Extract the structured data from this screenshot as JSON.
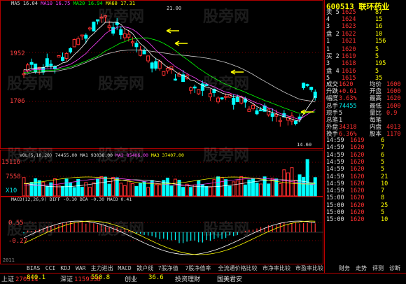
{
  "stock": {
    "code_title": "600513 联环药业"
  },
  "main_chart": {
    "ma_header": [
      "MA5 16.04",
      "MA10 16.75",
      "MA20 16.94",
      "MA60 17.31"
    ],
    "y_labels": [
      "1952",
      "1706"
    ],
    "high_label": "21.00",
    "low_label": "14.60"
  },
  "volume_chart": {
    "header": [
      "VOL(5,10,20)",
      "74455.00",
      "MA1 93038.00",
      "MA2 85406.00",
      "MA3 37407.00"
    ],
    "y_labels": [
      "15116",
      "7558",
      "X10"
    ]
  },
  "macd_chart": {
    "header": "MACD(12,26,9)  DIFF -0.10  DEA -0.30  MACD 0.41",
    "y_labels": [
      "0.55",
      "-0.27"
    ]
  },
  "order_book": [
    {
      "side": "卖",
      "level": "5",
      "price": "1625",
      "vol": "87"
    },
    {
      "side": "",
      "level": "4",
      "price": "1624",
      "vol": "15"
    },
    {
      "side": "",
      "level": "3",
      "price": "1623",
      "vol": "16"
    },
    {
      "side": "盘",
      "level": "2",
      "price": "1622",
      "vol": "10"
    },
    {
      "side": "",
      "level": "1",
      "price": "1621",
      "vol": "156"
    },
    {
      "side": "",
      "level": "1",
      "price": "1620",
      "vol": "5"
    },
    {
      "side": "买",
      "level": "2",
      "price": "1619",
      "vol": "5"
    },
    {
      "side": "",
      "level": "3",
      "price": "1618",
      "vol": "195"
    },
    {
      "side": "盘",
      "level": "4",
      "price": "1616",
      "vol": "5"
    },
    {
      "side": "",
      "level": "5",
      "price": "1615",
      "vol": "35"
    }
  ],
  "quote_stats": [
    {
      "label": "成交",
      "value": "1620",
      "label2": "均价",
      "value2": "1600"
    },
    {
      "label": "升跌",
      "value": "+0.61",
      "label2": "开盘",
      "value2": "1600"
    },
    {
      "label": "幅度",
      "value": "3.63%",
      "label2": "最高",
      "value2": "1620"
    },
    {
      "label": "总手",
      "value": "74455",
      "label2": "最低",
      "value2": "1600"
    },
    {
      "label": "现手",
      "value": "5",
      "label2": "量比",
      "value2": "0.9"
    },
    {
      "label": "总笔",
      "value": "1",
      "label2": "每笔",
      "value2": ""
    },
    {
      "label": "外盘",
      "value": "34318",
      "label2": "内盘",
      "value2": "4013"
    },
    {
      "label": "换手",
      "value": "6.36%",
      "label2": "股本",
      "value2": "1170"
    }
  ],
  "trades": [
    {
      "time": "14:59",
      "price": "1619",
      "vol": "6"
    },
    {
      "time": "14:59",
      "price": "1620",
      "vol": "7"
    },
    {
      "time": "14:59",
      "price": "1620",
      "vol": "6"
    },
    {
      "time": "14:59",
      "price": "1620",
      "vol": "5"
    },
    {
      "time": "14:59",
      "price": "1620",
      "vol": "5"
    },
    {
      "time": "14:59",
      "price": "1620",
      "vol": "21"
    },
    {
      "time": "14:59",
      "price": "1620",
      "vol": "10"
    },
    {
      "time": "14:59",
      "price": "1620",
      "vol": "7"
    },
    {
      "time": "15:00",
      "price": "1620",
      "vol": "8"
    },
    {
      "time": "15:00",
      "price": "1620",
      "vol": "25"
    },
    {
      "time": "15:00",
      "price": "1620",
      "vol": "5"
    },
    {
      "time": "15:00",
      "price": "1620",
      "vol": "10"
    }
  ],
  "bottom_tabs": [
    "BIAS",
    "CCI",
    "KDJ",
    "WAR",
    "主力进出",
    "MACD",
    "散户线",
    "7股净值",
    "7股净值率",
    "全流通价格比较",
    "市净率比较",
    "市盈率比较"
  ],
  "right_tabs": [
    "财务",
    "走势",
    "评测",
    "诊断"
  ],
  "status_bar": [
    {
      "label": "上证",
      "value": "270514",
      "color": "#ff3030"
    },
    {
      "label": "",
      "value": "840.1",
      "color": "#ffff00"
    },
    {
      "label": "深证",
      "value": "1159338",
      "color": "#ff3030"
    },
    {
      "label": "",
      "value": "550.8",
      "color": "#ffff00"
    },
    {
      "label": "创业",
      "value": "",
      "color": "#ff3030"
    },
    {
      "label": "",
      "value": "36.6",
      "color": "#ffff00"
    },
    {
      "label": "投资理财",
      "value": "",
      "color": "#ddd"
    },
    {
      "label": "国美君安",
      "value": "",
      "color": "#ddd"
    }
  ],
  "watermark": "股旁网",
  "corner_label": "2011"
}
